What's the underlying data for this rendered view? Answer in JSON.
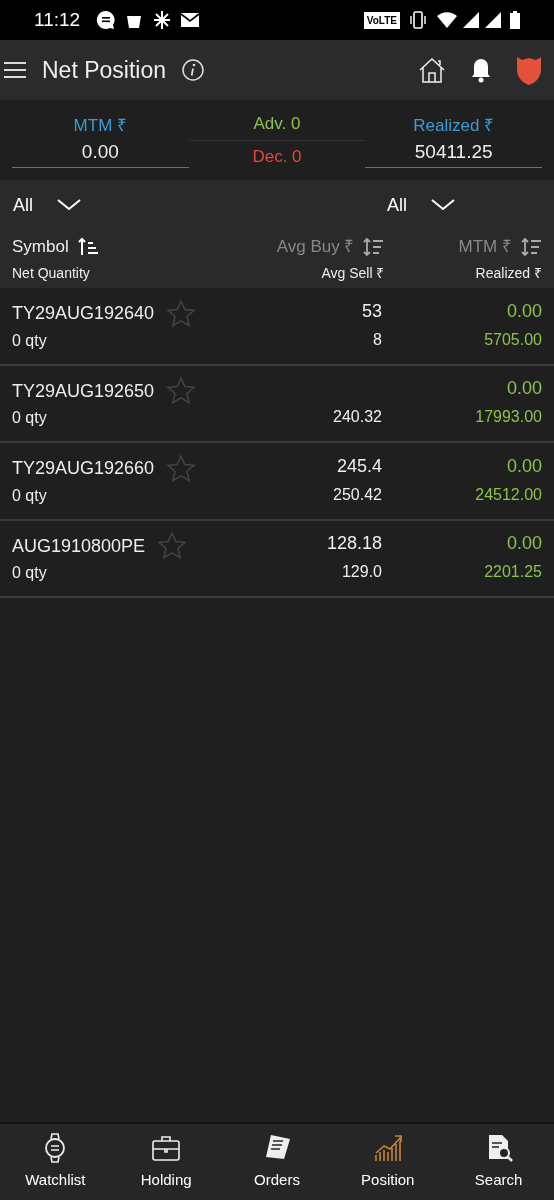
{
  "status_bar": {
    "time": "11:12",
    "network_badge": "VoLTE"
  },
  "header": {
    "title": "Net Position"
  },
  "summary": {
    "mtm_label": "MTM ₹",
    "mtm_value": "0.00",
    "adv": "Adv. 0",
    "dec": "Dec. 0",
    "realized_label": "Realized ₹",
    "realized_value": "50411.25"
  },
  "filters": [
    {
      "label": "All"
    },
    {
      "label": "All"
    }
  ],
  "columns": {
    "symbol": "Symbol",
    "net_quantity": "Net Quantity",
    "avg_buy": "Avg Buy ₹",
    "avg_sell": "Avg Sell ₹",
    "mtm": "MTM ₹",
    "realized": "Realized ₹"
  },
  "rows": [
    {
      "symbol": "TY29AUG192640",
      "qty": "0 qty",
      "buy": "53",
      "sell": "8",
      "mtm": "0.00",
      "realized": "5705.00",
      "starred": false
    },
    {
      "symbol": "TY29AUG192650",
      "qty": "0 qty",
      "sell": "240.32",
      "mtm": "0.00",
      "realized": "17993.00",
      "starred": false
    },
    {
      "symbol": "TY29AUG192660",
      "qty": "0 qty",
      "buy": "245.4",
      "sell": "250.42",
      "mtm": "0.00",
      "realized": "24512.00",
      "starred": false
    },
    {
      "symbol": "AUG1910800PE",
      "qty": "0 qty",
      "buy": "128.18",
      "sell": "129.0",
      "mtm": "0.00",
      "realized": "2201.25",
      "starred": false
    }
  ],
  "nav": [
    {
      "label": "Watchlist",
      "selected": false
    },
    {
      "label": "Holding",
      "selected": false
    },
    {
      "label": "Orders",
      "selected": false
    },
    {
      "label": "Position",
      "selected": true
    },
    {
      "label": "Search",
      "selected": false
    }
  ]
}
